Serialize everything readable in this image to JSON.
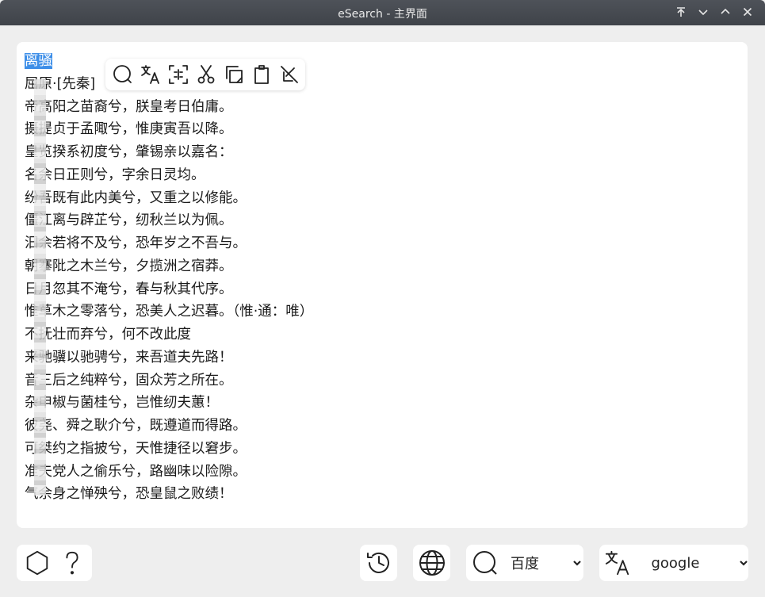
{
  "window": {
    "title": "eSearch - 主界面"
  },
  "editor": {
    "selected_text": "离骚",
    "lines": [
      "屈原·[先秦]",
      "帝高阳之苗裔兮，朕皇考日伯庸。",
      "摄提贞于孟陬兮，惟庚寅吾以降。",
      "皇览揆系初度兮，肇锡亲以嘉名：",
      "名余日正则兮，字余日灵均。",
      "纷吾既有此内美兮，又重之以修能。",
      "僵江离与辟芷兮，纫秋兰以为佩。",
      "汩余若将不及兮，恐年岁之不吾与。",
      "朝搴阰之木兰兮，夕揽洲之宿莽。",
      "日月忽其不淹兮，春与秋其代序。",
      "惟草木之零落兮，恐美人之迟暮。（惟·通：唯）",
      "不抚壮而弃兮，何不改此度",
      "来驰骥以驰骋兮，来吾道夫先路！",
      "音三后之纯粹兮，固众芳之所在。",
      "杂申椒与菌桂兮，岂惟纫夫蕙！",
      "彼尧、舜之耿介兮，既遵道而得路。",
      "可桀约之指披兮，天惟捷径以窘步。",
      "准夫党人之偷乐兮，路幽味以险隙。",
      "气余身之惮殃兮，恐皇鼠之败绩！"
    ]
  },
  "search": {
    "engine": "百度"
  },
  "translate": {
    "engine": "google"
  },
  "icons": {
    "floating_toolbar": [
      "search-icon",
      "translate-icon",
      "scan-icon",
      "cut-icon",
      "copy-icon",
      "paste-icon",
      "hide-icon"
    ],
    "bottom_left": [
      "hexagon-icon",
      "help-icon"
    ],
    "bottom_right": [
      "history-icon",
      "globe-icon",
      "search-icon",
      "translate-icon"
    ]
  }
}
